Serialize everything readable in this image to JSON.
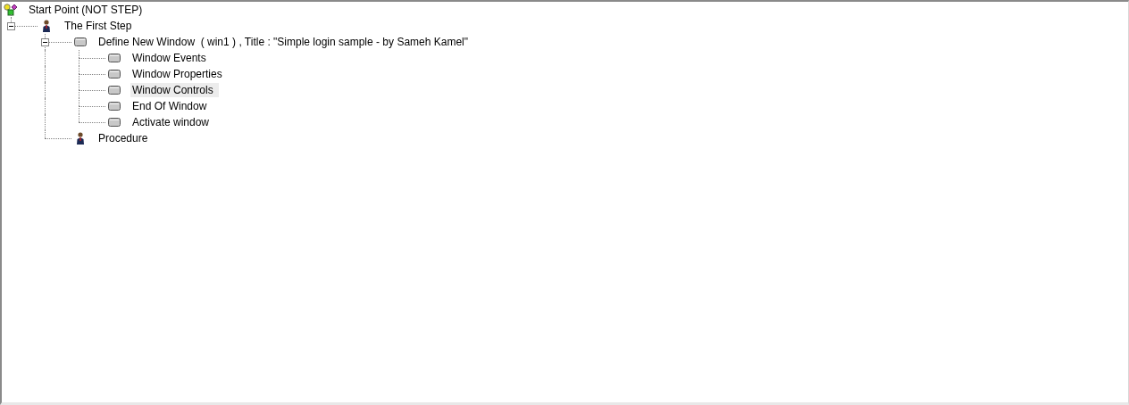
{
  "tree": [
    {
      "label": "Start Point (NOT STEP)",
      "kind": "root",
      "selected": false,
      "children": [
        {
          "label": "The First Step",
          "kind": "step",
          "selected": false,
          "expanded": true,
          "children": [
            {
              "label": "Define New Window  ( win1 ) , Title : \"Simple login sample - by Sameh Kamel\"",
              "kind": "window",
              "selected": false,
              "expanded": true,
              "children": [
                {
                  "label": "Window Events",
                  "kind": "window",
                  "selected": false
                },
                {
                  "label": "Window Properties",
                  "kind": "window",
                  "selected": false
                },
                {
                  "label": "Window Controls",
                  "kind": "window",
                  "selected": true
                },
                {
                  "label": "End Of Window",
                  "kind": "window",
                  "selected": false
                },
                {
                  "label": "Activate window",
                  "kind": "window",
                  "selected": false
                }
              ]
            },
            {
              "label": "Procedure",
              "kind": "step",
              "selected": false
            }
          ]
        }
      ]
    }
  ]
}
